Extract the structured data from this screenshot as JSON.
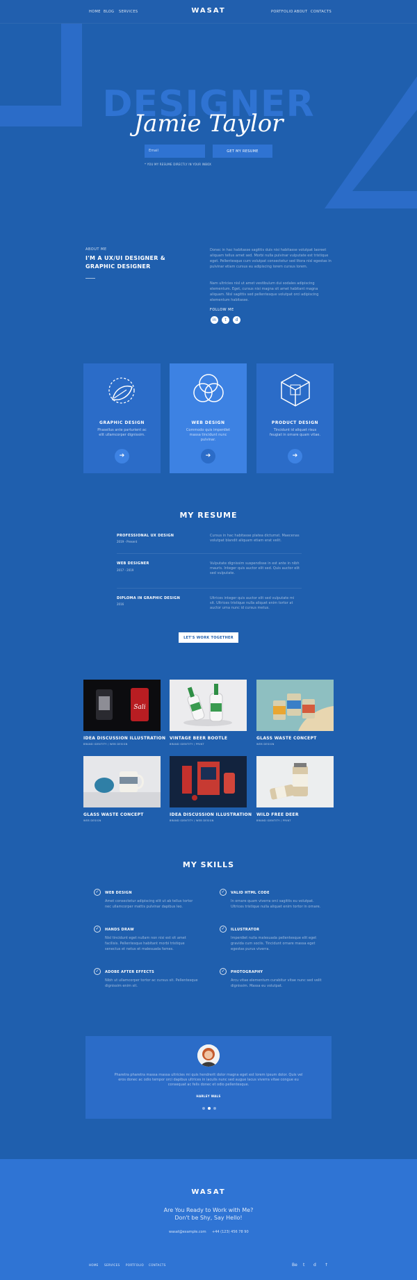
{
  "nav": {
    "left": [
      "HOME",
      "BLOG",
      "SERVICES"
    ],
    "logo": "WASAT",
    "right": [
      "PORTFOLIO",
      "ABOUT",
      "CONTACTS"
    ]
  },
  "hero": {
    "title": "DESIGNER",
    "name": "Jamie Taylor",
    "email_placeholder": "Email",
    "button": "GET MY RESUME",
    "note": "* YOU MY RESUME DIRECTLY IN YOUR INBOX"
  },
  "about": {
    "kicker": "ABOUT ME",
    "title": "I'M A UX/UI DESIGNER & GRAPHIC DESIGNER",
    "para1": "Donec in hac habitasse sagittis duis nisi habitasse volutpat laoreet aliquam tellus amet sed. Morbi nulla pulvinar vulputate est tristique eget. Pellentesque cum volutpat consectetur sed litora nisl egestas in pulvinar etiam cursus eu adipiscing lorem cursus lorem.",
    "para2": "Nam ultricies nisl ut amet vestibulum dui sodales adipiscing elementum. Eget, cursus nisi magna sit amet habitant magna aliquam. Nisl sagittis sed pellentesque volutpat orci adipiscing elementum habitasse.",
    "follow": "FOLLOW ME",
    "social": [
      "in",
      "t",
      "d"
    ]
  },
  "services": [
    {
      "title": "GRAPHIC DESIGN",
      "text": "Phasellus ante parturient ac elit ullamcorper dignissim.",
      "icon": "leaf-icon"
    },
    {
      "title": "WEB DESIGN",
      "text": "Commodo quis imperdiet massa tincidunt nunc pulvinar.",
      "icon": "circles-icon"
    },
    {
      "title": "PRODUCT DESIGN",
      "text": "Tincidunt id aliquet risus feugiat in ornare quam vitae.",
      "icon": "cube-icon"
    }
  ],
  "resume": {
    "title": "MY RESUME",
    "items": [
      {
        "title": "PROFESSIONAL UX DESIGN",
        "date": "2019 - Present",
        "desc": "Cursus in hac habitasse platea dictumst. Maecenas volutpat blandit aliquam etiam erat velit."
      },
      {
        "title": "WEB DESIGNER",
        "date": "2017 - 2019",
        "desc": "Vulputate dignissim suspendisse in est ante in nibh mauris. Integer quis auctor elit sed. Quis auctor elit sed vulputate."
      },
      {
        "title": "DIPLOMA IN GRAPHIC DESIGN",
        "date": "2016",
        "desc": "Ultrices integer quis auctor elit sed vulputate mi sit. Ultrices tristique nulla aliquet enim tortor at auctor urna nunc id cursus metus."
      }
    ],
    "button": "LET'S WORK TOGETHER"
  },
  "portfolio": [
    {
      "title": "IDEA DISCUSSION ILLUSTRATION",
      "cat": "BRAND IDENTITY / WEB DESIGN"
    },
    {
      "title": "VINTAGE BEER BOOTLE",
      "cat": "BRAND IDENTITY / PRINT"
    },
    {
      "title": "GLASS WASTE CONCEPT",
      "cat": "WEB DESIGN"
    },
    {
      "title": "GLASS WASTE CONCEPT",
      "cat": "WEB DESIGN"
    },
    {
      "title": "IDEA DISCUSSION ILLUSTRATION",
      "cat": "BRAND IDENTITY / WEB DESIGN"
    },
    {
      "title": "WILD FREE DEER",
      "cat": "BRAND IDENTITY / PRINT"
    }
  ],
  "skills": {
    "title": "MY SKILLS",
    "items": [
      {
        "name": "WEB DESIGN",
        "desc": "Amet consectetur adipiscing elit ut ab tellus tortor nec ullamcorper mattis pulvinar dapibus leo."
      },
      {
        "name": "VALID HTML CODE",
        "desc": "In ornare quam viverra orci sagittis eu volutpat. Ultrices tristique nulla aliquet enim tortor in ornare."
      },
      {
        "name": "HANDS DRAW",
        "desc": "Nisl tincidunt eget nullam non nisi est sit amet facilisis. Pellentesque habitant morbi tristique senectus et netus et malesuada fames."
      },
      {
        "name": "ILLUSTRATOR",
        "desc": "Imperdiet nulla malesuada pellentesque elit eget gravida cum sociis. Tincidunt ornare massa eget egestas purus viverra."
      },
      {
        "name": "ADOBE AFTER EFFECTS",
        "desc": "Nibh ut ullamcorper tortor ac cursus sit. Pellentesque dignissim enim sit."
      },
      {
        "name": "PHOTOGRAPHY",
        "desc": "Arcu vitae elementum curabitur vitae nunc sed velit dignissim. Massa eu volutpat."
      }
    ]
  },
  "testimonial": {
    "text": "Pharetra pharetra massa massa ultricies mi quis hendrerit dolor magna eget est lorem ipsum dolor. Quis vel eros donec ac odio tempor orci dapibus ultrices in iaculis nunc sed augue lacus viverra vitae congue eu consequat ac felis donec et odio pellentesque.",
    "name": "HARLEY WALS"
  },
  "footer": {
    "logo": "WASAT",
    "line1": "Are You Ready to Work with Me?",
    "line2": "Don't be Shy, Say Hello!",
    "email": "wasat@example.com",
    "phone": "+44 (123) 456 78 90",
    "links": [
      "HOME",
      "SERVICES",
      "PORTFOLIO",
      "CONTACTS"
    ],
    "social": [
      "Be",
      "t",
      "d",
      "↑"
    ]
  },
  "colors": {
    "background": "#1f5fae",
    "card": "#2b6cc8",
    "accent": "#3d82e3",
    "footer": "#2f74d4"
  }
}
